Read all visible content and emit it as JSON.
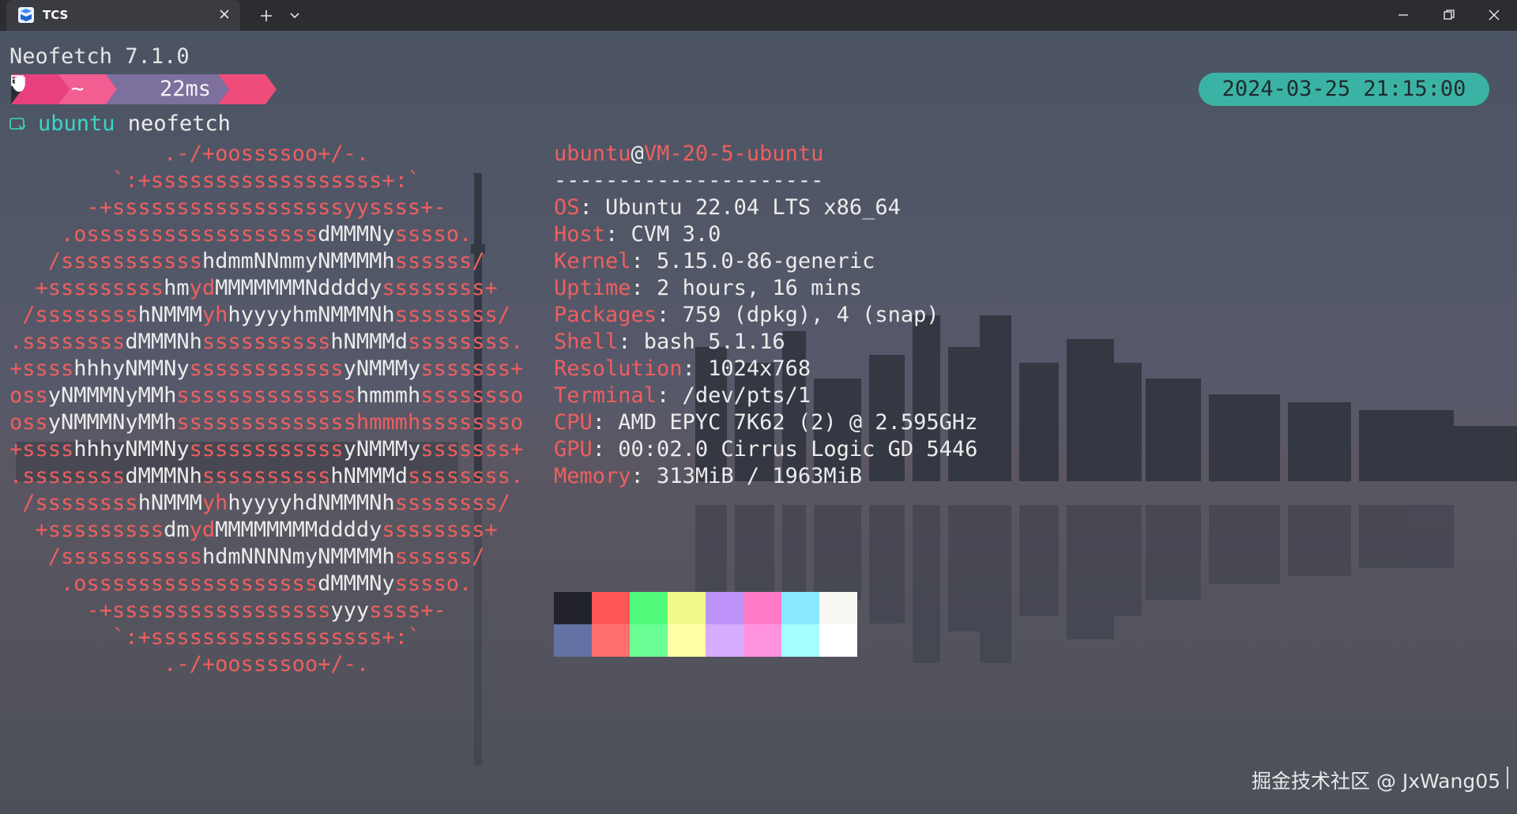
{
  "window": {
    "tab_title": "TCS",
    "icons": [
      "terminal-app-icon",
      "close-icon",
      "plus-icon",
      "chevron-down-icon",
      "minimize-icon",
      "maximize-icon",
      "close-icon"
    ]
  },
  "terminal": {
    "version_line": "Neofetch 7.1.0",
    "prompt": {
      "path_symbol": "~",
      "duration": "22ms",
      "datetime": "2024-03-25 21:15:00",
      "segment_colors": [
        "#e8407f",
        "#f25d92",
        "#7d6f9e",
        "#ee4c7a"
      ],
      "icons": [
        "folder-icon",
        "timer-icon",
        "hand-icon"
      ]
    },
    "command": {
      "user": "ubuntu",
      "text": " neofetch"
    },
    "ascii_logo": [
      [
        [
          "r",
          "            .-/+oossssoo+/-."
        ]
      ],
      [
        [
          "r",
          "        `:+ssssssssssssssssss+:`"
        ]
      ],
      [
        [
          "r",
          "      -+ssssssssssssssssssyyssss+-"
        ]
      ],
      [
        [
          "r",
          "    .ossssssssssssssssss"
        ],
        [
          "w",
          "dMMMNy"
        ],
        [
          "r",
          "sssso."
        ]
      ],
      [
        [
          "r",
          "   /sssssssssss"
        ],
        [
          "w",
          "hdmmNNmmyNMMMMh"
        ],
        [
          "r",
          "ssssss/"
        ]
      ],
      [
        [
          "r",
          "  +sssssssss"
        ],
        [
          "w",
          "hm"
        ],
        [
          "r",
          "yd"
        ],
        [
          "w",
          "MMMMMMMNddddy"
        ],
        [
          "r",
          "ssssssss+"
        ]
      ],
      [
        [
          "r",
          " /ssssssss"
        ],
        [
          "w",
          "hNMMM"
        ],
        [
          "r",
          "yh"
        ],
        [
          "w",
          "hyyyyhmNMMMNh"
        ],
        [
          "r",
          "ssssssss/"
        ]
      ],
      [
        [
          "r",
          ".ssssssss"
        ],
        [
          "w",
          "dMMMNh"
        ],
        [
          "r",
          "ssssssssss"
        ],
        [
          "w",
          "hNMMMd"
        ],
        [
          "r",
          "ssssssss."
        ]
      ],
      [
        [
          "r",
          "+ssss"
        ],
        [
          "w",
          "hhhyNMMNy"
        ],
        [
          "r",
          "ssssssssssss"
        ],
        [
          "w",
          "yNMMMy"
        ],
        [
          "r",
          "sssssss+"
        ]
      ],
      [
        [
          "r",
          "oss"
        ],
        [
          "w",
          "yNMMMNyMMh"
        ],
        [
          "r",
          "ssssssssssssss"
        ],
        [
          "w",
          "hmmmh"
        ],
        [
          "r",
          "ssssssso"
        ]
      ],
      [
        [
          "r",
          "oss"
        ],
        [
          "w",
          "yNMMMNyMMh"
        ],
        [
          "r",
          "sssssssssssssshmmmhssssssso"
        ]
      ],
      [
        [
          "r",
          "+ssss"
        ],
        [
          "w",
          "hhhyNMMNy"
        ],
        [
          "r",
          "ssssssssssss"
        ],
        [
          "w",
          "yNMMMy"
        ],
        [
          "r",
          "sssssss+"
        ]
      ],
      [
        [
          "r",
          ".ssssssss"
        ],
        [
          "w",
          "dMMMNh"
        ],
        [
          "r",
          "ssssssssss"
        ],
        [
          "w",
          "hNMMMd"
        ],
        [
          "r",
          "ssssssss."
        ]
      ],
      [
        [
          "r",
          " /ssssssss"
        ],
        [
          "w",
          "hNMMM"
        ],
        [
          "r",
          "yh"
        ],
        [
          "w",
          "hyyyyhdNMMMNh"
        ],
        [
          "r",
          "ssssssss/"
        ]
      ],
      [
        [
          "r",
          "  +sssssssss"
        ],
        [
          "w",
          "dm"
        ],
        [
          "r",
          "yd"
        ],
        [
          "w",
          "MMMMMMMMddddy"
        ],
        [
          "r",
          "ssssssss+"
        ]
      ],
      [
        [
          "r",
          "   /sssssssssss"
        ],
        [
          "w",
          "hdmNNNNmyNMMMMh"
        ],
        [
          "r",
          "ssssss/"
        ]
      ],
      [
        [
          "r",
          "    .ossssssssssssssssss"
        ],
        [
          "w",
          "dMMMNy"
        ],
        [
          "r",
          "sssso."
        ]
      ],
      [
        [
          "r",
          "      -+sssssssssssssssss"
        ],
        [
          "w",
          "yyy"
        ],
        [
          "r",
          "ssss+-"
        ]
      ],
      [
        [
          "r",
          "        `:+ssssssssssssssssss+:`"
        ]
      ],
      [
        [
          "r",
          "            .-/+oossssoo+/-."
        ]
      ]
    ],
    "info": {
      "user": "ubuntu",
      "at": "@",
      "host": "VM-20-5-ubuntu",
      "separator": "---------------------",
      "rows": [
        {
          "key": "OS",
          "value": ": Ubuntu 22.04 LTS x86_64"
        },
        {
          "key": "Host",
          "value": ": CVM 3.0"
        },
        {
          "key": "Kernel",
          "value": ": 5.15.0-86-generic"
        },
        {
          "key": "Uptime",
          "value": ": 2 hours, 16 mins"
        },
        {
          "key": "Packages",
          "value": ": 759 (dpkg), 4 (snap)"
        },
        {
          "key": "Shell",
          "value": ": bash 5.1.16"
        },
        {
          "key": "Resolution",
          "value": ": 1024x768"
        },
        {
          "key": "Terminal",
          "value": ": /dev/pts/1"
        },
        {
          "key": "CPU",
          "value": ": AMD EPYC 7K62 (2) @ 2.595GHz"
        },
        {
          "key": "GPU",
          "value": ": 00:02.0 Cirrus Logic GD 5446"
        },
        {
          "key": "Memory",
          "value": ": 313MiB / 1963MiB"
        }
      ]
    },
    "palette": {
      "normal": [
        "#21222c",
        "#ff5555",
        "#50fa7b",
        "#f1fa8c",
        "#bd93f9",
        "#ff79c6",
        "#8be9fd",
        "#f8f8f2"
      ],
      "bright": [
        "#6272a4",
        "#ff6e6e",
        "#69ff94",
        "#ffffa5",
        "#d6acff",
        "#ff92df",
        "#a4ffff",
        "#ffffff"
      ]
    }
  },
  "watermark": "掘金技术社区 @ JxWang05"
}
